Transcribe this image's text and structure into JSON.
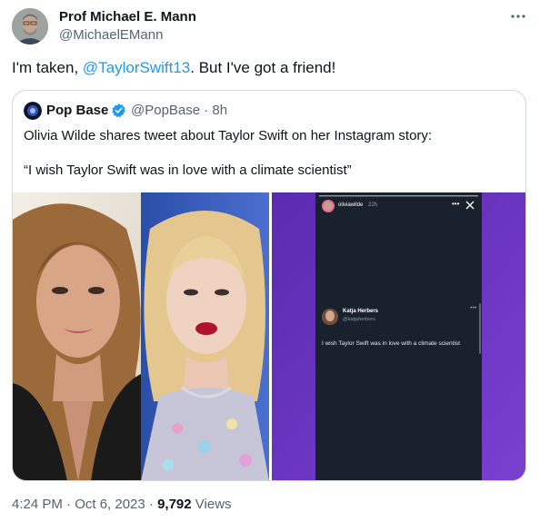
{
  "author": {
    "name": "Prof Michael E. Mann",
    "handle": "@MichaelEMann"
  },
  "tweet": {
    "text_before": "I'm taken, ",
    "mention": "@TaylorSwift13",
    "text_after": ". But I've got a friend!"
  },
  "quote": {
    "name": "Pop Base",
    "handle_time": "@PopBase · 8h",
    "line1": "Olivia Wilde shares tweet about Taylor Swift on her Instagram story:",
    "line2": "“I wish Taylor Swift was in love with a climate scientist”",
    "story": {
      "user": "oliviawilde",
      "time": "22h",
      "reply_name": "Katja Herbers",
      "reply_handle": "@katjaherbers",
      "reply_text": "I wish Taylor Swift was in love with a climate scientist"
    }
  },
  "meta": {
    "time_date": "4:24 PM · Oct 6, 2023 · ",
    "views_count": "9,792",
    "views_label": " Views"
  },
  "colors": {
    "link": "#1d9bf0",
    "secondary_text": "#536471",
    "story_bg": "#18212c",
    "story_purple": "#6a2fb5"
  }
}
